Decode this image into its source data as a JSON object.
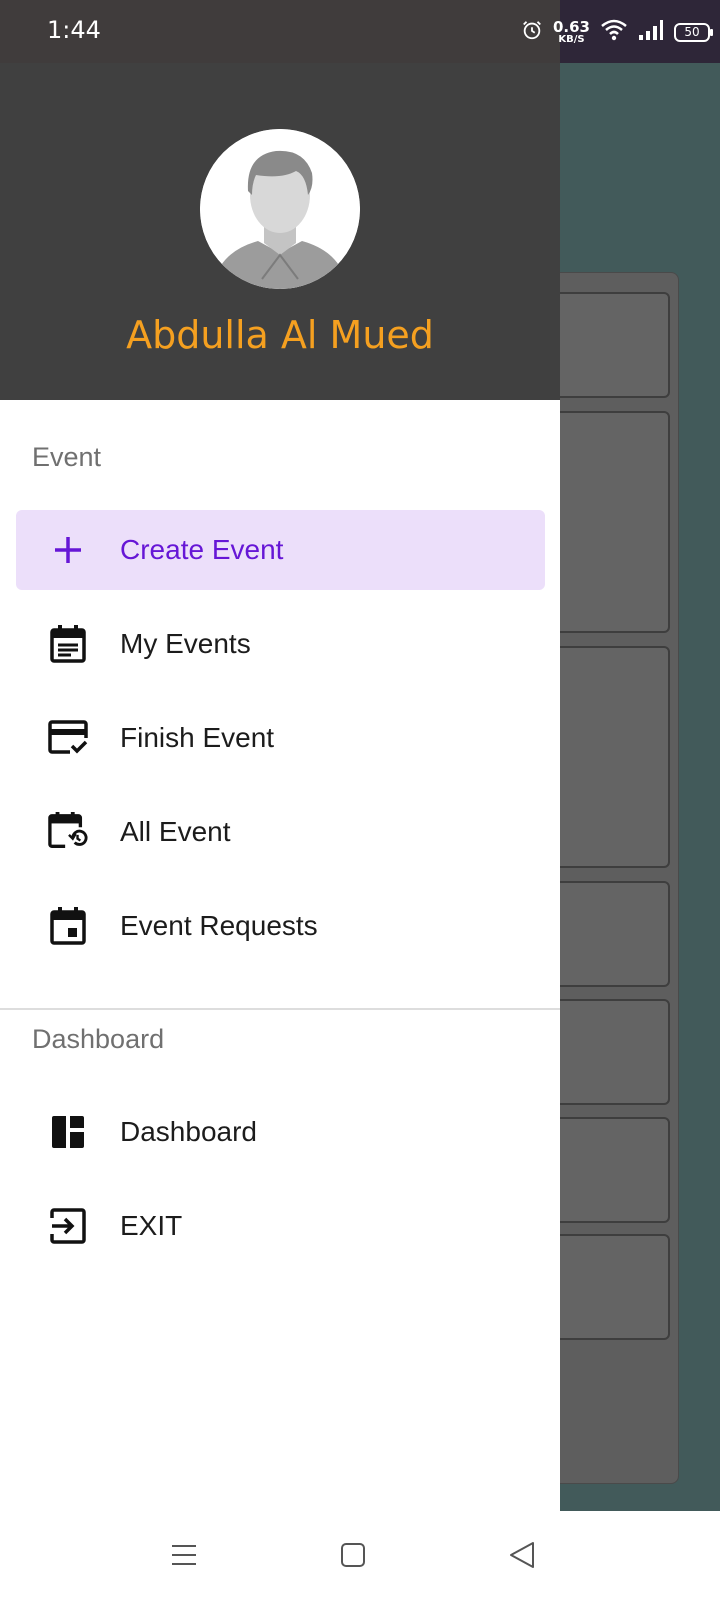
{
  "status_bar": {
    "time": "1:44",
    "speed_value": "0.63",
    "speed_unit": "KB/S",
    "battery": "50",
    "icons": [
      "alarm-icon",
      "wifi-icon",
      "signal-icon",
      "battery-icon"
    ]
  },
  "drawer": {
    "user_name": "Abdulla Al Mued",
    "sections": {
      "event": {
        "title": "Event",
        "items": [
          {
            "label": "Create Event",
            "icon": "add-icon",
            "active": true
          },
          {
            "label": "My Events",
            "icon": "event-note-icon"
          },
          {
            "label": "Finish Event",
            "icon": "card-check-icon"
          },
          {
            "label": "All Event",
            "icon": "calendar-history-icon"
          },
          {
            "label": "Event Requests",
            "icon": "event-icon"
          }
        ]
      },
      "dashboard": {
        "title": "Dashboard",
        "items": [
          {
            "label": "Dashboard",
            "icon": "dashboard-icon"
          },
          {
            "label": "EXIT",
            "icon": "exit-icon"
          }
        ]
      }
    }
  },
  "colors": {
    "header_bg": "#404040",
    "name_color": "#f5a020",
    "active_bg": "#ecdffa",
    "active_text": "#6616d6",
    "scrim": "#425a5a"
  },
  "nav_bar": {
    "buttons": [
      "menu-icon",
      "home-square-icon",
      "back-triangle-icon"
    ]
  }
}
